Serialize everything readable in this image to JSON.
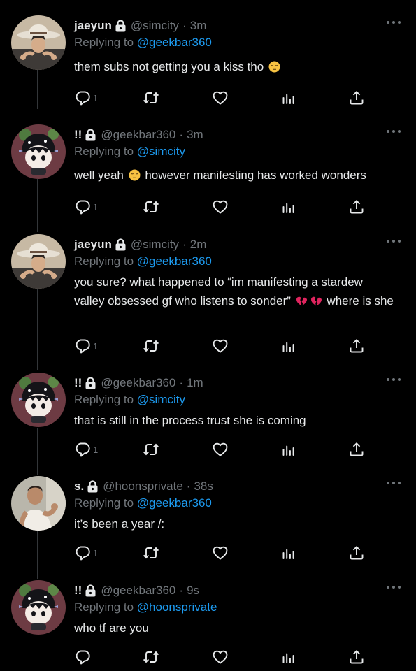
{
  "colors": {
    "background": "#000000",
    "text": "#e7e9ea",
    "muted": "#71767b",
    "link": "#1d9bf0",
    "thread_line": "#333639"
  },
  "icons": {
    "lock": "lock-icon",
    "more": "more-dots-icon",
    "reply": "reply-icon",
    "retweet": "retweet-icon",
    "like": "heart-icon",
    "views": "views-chart-icon",
    "share": "share-icon",
    "emoji_pensive": "pensive-face-emoji",
    "emoji_broken_heart": "broken-heart-emoji"
  },
  "replying_to_label": "Replying to",
  "separator": "·",
  "tweets": [
    {
      "name": "jaeyun",
      "handle": "@simcity",
      "time": "3m",
      "reply_to": "@geekbar360",
      "text_parts": [
        "them subs not getting you a kiss tho"
      ],
      "reply_count": "1"
    },
    {
      "name": "!!",
      "handle": "@geekbar360",
      "time": "3m",
      "reply_to": "@simcity",
      "text_parts": [
        "well yeah",
        "however manifesting has worked wonders"
      ],
      "reply_count": "1"
    },
    {
      "name": "jaeyun",
      "handle": "@simcity",
      "time": "2m",
      "reply_to": "@geekbar360",
      "text_parts": [
        "you sure? what happened to “im manifesting a stardew valley obsessed gf who listens to sonder”",
        "where is she"
      ],
      "reply_count": "1"
    },
    {
      "name": "!!",
      "handle": "@geekbar360",
      "time": "1m",
      "reply_to": "@simcity",
      "text_parts": [
        "that is still in the process trust she is coming"
      ],
      "reply_count": "1"
    },
    {
      "name": "s.",
      "handle": "@hoonsprivate",
      "time": "38s",
      "reply_to": "@geekbar360",
      "text_parts": [
        "it’s been a year /:"
      ],
      "reply_count": "1"
    },
    {
      "name": "!!",
      "handle": "@geekbar360",
      "time": "9s",
      "reply_to": "@hoonsprivate",
      "text_parts": [
        "who tf are you"
      ],
      "reply_count": ""
    }
  ]
}
